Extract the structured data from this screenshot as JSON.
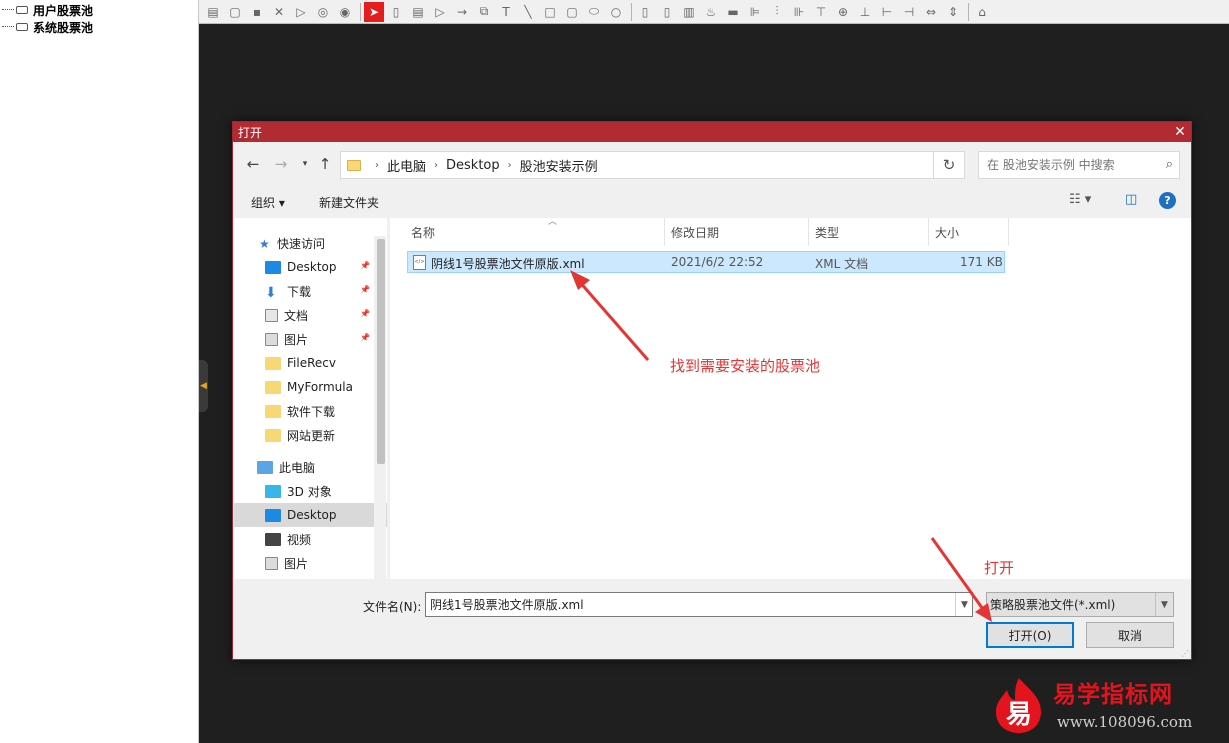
{
  "tree": {
    "items": [
      {
        "label": "用户股票池"
      },
      {
        "label": "系统股票池"
      }
    ]
  },
  "toolbar": {
    "icons": [
      "new-doc-icon",
      "frame-icon",
      "save-icon",
      "close-icon",
      "play-icon",
      "pause-icon",
      "stop-icon",
      "cursor-icon",
      "shape-icon",
      "list-icon",
      "arrow-right-icon",
      "arrow-icon",
      "copy-format-icon",
      "text-icon",
      "line-icon",
      "rectangle-icon",
      "rounded-rect-icon",
      "ellipse-icon",
      "circle-icon",
      "page-icon",
      "page2-icon",
      "delete-icon",
      "paint-icon",
      "divider-icon",
      "align-left-icon",
      "align-center-icon",
      "align-right-icon",
      "align-top-icon",
      "align-middle-icon",
      "align-bottom-icon",
      "distribute-h-icon",
      "distribute-v-icon",
      "same-width-icon",
      "same-height-icon",
      "bank-icon"
    ]
  },
  "dialog": {
    "title": "打开",
    "breadcrumb": [
      "此电脑",
      "Desktop",
      "股池安装示例"
    ],
    "search_placeholder": "在 股池安装示例 中搜索",
    "organize": "组织 ▾",
    "new_folder": "新建文件夹",
    "nav": [
      {
        "label": "快速访问",
        "icon": "star-icon",
        "color": "#3a7bd5"
      },
      {
        "label": "Desktop",
        "icon": "desktop-icon",
        "color": "#1e88e5",
        "pinned": true
      },
      {
        "label": "下载",
        "icon": "download-icon",
        "color": "#2f7ed8",
        "pinned": true
      },
      {
        "label": "文档",
        "icon": "document-icon",
        "color": "#e6e6e6",
        "pinned": true
      },
      {
        "label": "图片",
        "icon": "picture-icon",
        "color": "#dcdcdc",
        "pinned": true
      },
      {
        "label": "FileRecv",
        "icon": "folder-icon",
        "color": "#f8d775"
      },
      {
        "label": "MyFormula",
        "icon": "folder-icon",
        "color": "#f8d775"
      },
      {
        "label": "软件下载",
        "icon": "folder-icon",
        "color": "#f8d775"
      },
      {
        "label": "网站更新",
        "icon": "folder-icon",
        "color": "#f8d775"
      },
      {
        "label": "此电脑",
        "icon": "computer-icon",
        "color": "#5ba4e5"
      },
      {
        "label": "3D 对象",
        "icon": "cube-icon",
        "color": "#38b6e8"
      },
      {
        "label": "Desktop",
        "icon": "desktop-icon",
        "color": "#1e88e5"
      },
      {
        "label": "视频",
        "icon": "video-icon",
        "color": "#444444"
      },
      {
        "label": "图片",
        "icon": "picture-icon",
        "color": "#dcdcdc"
      }
    ],
    "columns": [
      "名称",
      "修改日期",
      "类型",
      "大小"
    ],
    "files": [
      {
        "name": "阴线1号股票池文件原版.xml",
        "date": "2021/6/2 22:52",
        "type": "XML 文档",
        "size": "171 KB"
      }
    ],
    "filename_label": "文件名(N):",
    "filename_value": "阴线1号股票池文件原版.xml",
    "filter": "策略股票池文件(*.xml)",
    "open_label": "打开(O)",
    "cancel_label": "取消"
  },
  "annotations": {
    "find_text": "找到需要安装的股票池",
    "open_text": "打开",
    "color": "#e53434"
  },
  "watermark": {
    "badge_char": "易",
    "title": "易学指标网",
    "url": "www.108096.com"
  }
}
